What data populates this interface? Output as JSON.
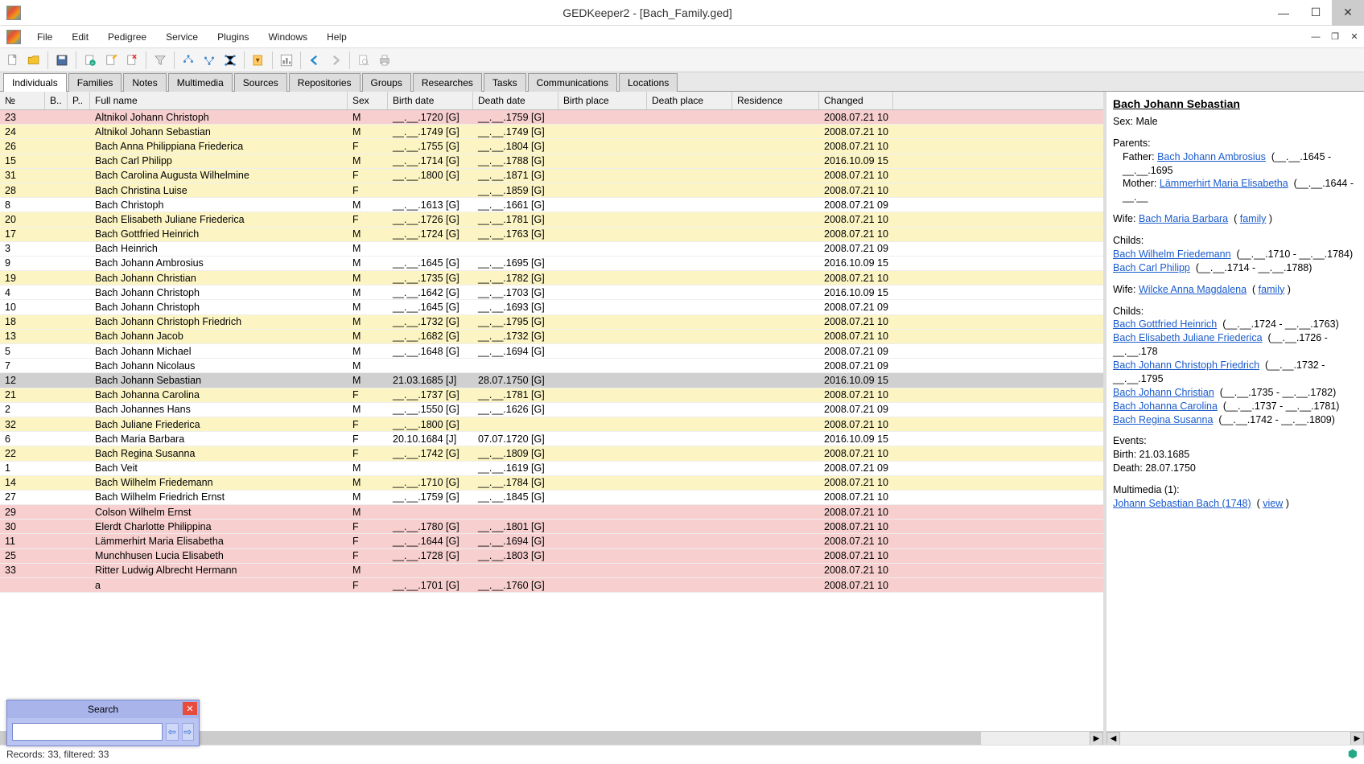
{
  "window": {
    "title": "GEDKeeper2 - [Bach_Family.ged]"
  },
  "menu": [
    "File",
    "Edit",
    "Pedigree",
    "Service",
    "Plugins",
    "Windows",
    "Help"
  ],
  "tabs": [
    "Individuals",
    "Families",
    "Notes",
    "Multimedia",
    "Sources",
    "Repositories",
    "Groups",
    "Researches",
    "Tasks",
    "Communications",
    "Locations"
  ],
  "columns": {
    "no": "№",
    "b": "B..",
    "p": "P..",
    "name": "Full name",
    "sex": "Sex",
    "birth": "Birth date",
    "death": "Death date",
    "bplace": "Birth place",
    "dplace": "Death place",
    "res": "Residence",
    "changed": "Changed"
  },
  "rows": [
    {
      "no": "23",
      "name": "Altnikol Johann Christoph",
      "sex": "M",
      "birth": "__.__.1720 [G]",
      "death": "__.__.1759 [G]",
      "changed": "2008.07.21 10",
      "cls": "pink"
    },
    {
      "no": "24",
      "name": "Altnikol Johann Sebastian",
      "sex": "M",
      "birth": "__.__.1749 [G]",
      "death": "__.__.1749 [G]",
      "changed": "2008.07.21 10",
      "cls": "yellow"
    },
    {
      "no": "26",
      "name": "Bach Anna Philippiana Friederica",
      "sex": "F",
      "birth": "__.__.1755 [G]",
      "death": "__.__.1804 [G]",
      "changed": "2008.07.21 10",
      "cls": "yellow"
    },
    {
      "no": "15",
      "name": "Bach Carl Philipp",
      "sex": "M",
      "birth": "__.__.1714 [G]",
      "death": "__.__.1788 [G]",
      "changed": "2016.10.09 15",
      "cls": "yellow"
    },
    {
      "no": "31",
      "name": "Bach Carolina Augusta Wilhelmine",
      "sex": "F",
      "birth": "__.__.1800 [G]",
      "death": "__.__.1871 [G]",
      "changed": "2008.07.21 10",
      "cls": "yellow"
    },
    {
      "no": "28",
      "name": "Bach Christina Luise",
      "sex": "F",
      "birth": "",
      "death": "__.__.1859 [G]",
      "changed": "2008.07.21 10",
      "cls": "yellow"
    },
    {
      "no": "8",
      "name": "Bach Christoph",
      "sex": "M",
      "birth": "__.__.1613 [G]",
      "death": "__.__.1661 [G]",
      "changed": "2008.07.21 09",
      "cls": ""
    },
    {
      "no": "20",
      "name": "Bach Elisabeth Juliane Friederica",
      "sex": "F",
      "birth": "__.__.1726 [G]",
      "death": "__.__.1781 [G]",
      "changed": "2008.07.21 10",
      "cls": "yellow"
    },
    {
      "no": "17",
      "name": "Bach Gottfried Heinrich",
      "sex": "M",
      "birth": "__.__.1724 [G]",
      "death": "__.__.1763 [G]",
      "changed": "2008.07.21 10",
      "cls": "yellow"
    },
    {
      "no": "3",
      "name": "Bach Heinrich",
      "sex": "M",
      "birth": "",
      "death": "",
      "changed": "2008.07.21 09",
      "cls": ""
    },
    {
      "no": "9",
      "name": "Bach Johann Ambrosius",
      "sex": "M",
      "birth": "__.__.1645 [G]",
      "death": "__.__.1695 [G]",
      "changed": "2016.10.09 15",
      "cls": ""
    },
    {
      "no": "19",
      "name": "Bach Johann Christian",
      "sex": "M",
      "birth": "__.__.1735 [G]",
      "death": "__.__.1782 [G]",
      "changed": "2008.07.21 10",
      "cls": "yellow"
    },
    {
      "no": "4",
      "name": "Bach Johann Christoph",
      "sex": "M",
      "birth": "__.__.1642 [G]",
      "death": "__.__.1703 [G]",
      "changed": "2016.10.09 15",
      "cls": ""
    },
    {
      "no": "10",
      "name": "Bach Johann Christoph",
      "sex": "M",
      "birth": "__.__.1645 [G]",
      "death": "__.__.1693 [G]",
      "changed": "2008.07.21 09",
      "cls": ""
    },
    {
      "no": "18",
      "name": "Bach Johann Christoph Friedrich",
      "sex": "M",
      "birth": "__.__.1732 [G]",
      "death": "__.__.1795 [G]",
      "changed": "2008.07.21 10",
      "cls": "yellow"
    },
    {
      "no": "13",
      "name": "Bach Johann Jacob",
      "sex": "M",
      "birth": "__.__.1682 [G]",
      "death": "__.__.1732 [G]",
      "changed": "2008.07.21 10",
      "cls": "yellow"
    },
    {
      "no": "5",
      "name": "Bach Johann Michael",
      "sex": "M",
      "birth": "__.__.1648 [G]",
      "death": "__.__.1694 [G]",
      "changed": "2008.07.21 09",
      "cls": ""
    },
    {
      "no": "7",
      "name": "Bach Johann Nicolaus",
      "sex": "M",
      "birth": "",
      "death": "",
      "changed": "2008.07.21 09",
      "cls": ""
    },
    {
      "no": "12",
      "name": "Bach Johann Sebastian",
      "sex": "M",
      "birth": "21.03.1685 [J]",
      "death": "28.07.1750 [G]",
      "changed": "2016.10.09 15",
      "cls": "selected"
    },
    {
      "no": "21",
      "name": "Bach Johanna Carolina",
      "sex": "F",
      "birth": "__.__.1737 [G]",
      "death": "__.__.1781 [G]",
      "changed": "2008.07.21 10",
      "cls": "yellow"
    },
    {
      "no": "2",
      "name": "Bach Johannes Hans",
      "sex": "M",
      "birth": "__.__.1550 [G]",
      "death": "__.__.1626 [G]",
      "changed": "2008.07.21 09",
      "cls": ""
    },
    {
      "no": "32",
      "name": "Bach Juliane Friederica",
      "sex": "F",
      "birth": "__.__.1800 [G]",
      "death": "",
      "changed": "2008.07.21 10",
      "cls": "yellow"
    },
    {
      "no": "6",
      "name": "Bach Maria Barbara",
      "sex": "F",
      "birth": "20.10.1684 [J]",
      "death": "07.07.1720 [G]",
      "changed": "2016.10.09 15",
      "cls": ""
    },
    {
      "no": "22",
      "name": "Bach Regina Susanna",
      "sex": "F",
      "birth": "__.__.1742 [G]",
      "death": "__.__.1809 [G]",
      "changed": "2008.07.21 10",
      "cls": "yellow"
    },
    {
      "no": "1",
      "name": "Bach Veit",
      "sex": "M",
      "birth": "",
      "death": "__.__.1619 [G]",
      "changed": "2008.07.21 09",
      "cls": ""
    },
    {
      "no": "14",
      "name": "Bach Wilhelm Friedemann",
      "sex": "M",
      "birth": "__.__.1710 [G]",
      "death": "__.__.1784 [G]",
      "changed": "2008.07.21 10",
      "cls": "yellow"
    },
    {
      "no": "27",
      "name": "Bach Wilhelm Friedrich Ernst",
      "sex": "M",
      "birth": "__.__.1759 [G]",
      "death": "__.__.1845 [G]",
      "changed": "2008.07.21 10",
      "cls": ""
    },
    {
      "no": "29",
      "name": "Colson Wilhelm Ernst",
      "sex": "M",
      "birth": "",
      "death": "",
      "changed": "2008.07.21 10",
      "cls": "pink"
    },
    {
      "no": "30",
      "name": "Elerdt Charlotte Philippina",
      "sex": "F",
      "birth": "__.__.1780 [G]",
      "death": "__.__.1801 [G]",
      "changed": "2008.07.21 10",
      "cls": "pink"
    },
    {
      "no": "11",
      "name": "Lämmerhirt Maria Elisabetha",
      "sex": "F",
      "birth": "__.__.1644 [G]",
      "death": "__.__.1694 [G]",
      "changed": "2008.07.21 10",
      "cls": "pink"
    },
    {
      "no": "25",
      "name": "Munchhusen Lucia Elisabeth",
      "sex": "F",
      "birth": "__.__.1728 [G]",
      "death": "__.__.1803 [G]",
      "changed": "2008.07.21 10",
      "cls": "pink"
    },
    {
      "no": "33",
      "name": "Ritter Ludwig Albrecht Hermann",
      "sex": "M",
      "birth": "",
      "death": "",
      "changed": "2008.07.21 10",
      "cls": "pink"
    },
    {
      "no": "",
      "name": "a",
      "sex": "F",
      "birth": "__.__.1701 [G]",
      "death": "__.__.1760 [G]",
      "changed": "2008.07.21 10",
      "cls": "pink"
    }
  ],
  "status": "Records: 33, filtered: 33",
  "search": {
    "title": "Search",
    "value": ""
  },
  "detail": {
    "title": "Bach Johann Sebastian",
    "sex_label": "Sex: Male",
    "parents_label": "Parents:",
    "father_label": "Father:",
    "father_link": "Bach Johann Ambrosius",
    "father_dates": "(__.__.1645 - __.__.1695",
    "mother_label": "Mother:",
    "mother_link": "Lämmerhirt Maria Elisabetha",
    "mother_dates": "(__.__.1644 - __.__",
    "wife1_label": "Wife:",
    "wife1_link": "Bach Maria Barbara",
    "family_label": "family",
    "childs_label": "Childs:",
    "child1_link": "Bach Wilhelm Friedemann",
    "child1_dates": "(__.__.1710 - __.__.1784)",
    "child2_link": "Bach Carl Philipp",
    "child2_dates": "(__.__.1714 - __.__.1788)",
    "wife2_label": "Wife:",
    "wife2_link": "Wilcke Anna Magdalena",
    "child3_link": "Bach Gottfried Heinrich",
    "child3_dates": "(__.__.1724 - __.__.1763)",
    "child4_link": "Bach Elisabeth Juliane Friederica",
    "child4_dates": "(__.__.1726 - __.__.178",
    "child5_link": "Bach Johann Christoph Friedrich",
    "child5_dates": "(__.__.1732 - __.__.1795",
    "child6_link": "Bach Johann Christian",
    "child6_dates": "(__.__.1735 - __.__.1782)",
    "child7_link": "Bach Johanna Carolina",
    "child7_dates": "(__.__.1737 - __.__.1781)",
    "child8_link": "Bach Regina Susanna",
    "child8_dates": "(__.__.1742 - __.__.1809)",
    "events_label": "Events:",
    "birth_event": "Birth: 21.03.1685",
    "death_event": "Death: 28.07.1750",
    "multimedia_label": "Multimedia (1):",
    "mm_link": "Johann Sebastian Bach (1748)",
    "view_label": "view"
  }
}
